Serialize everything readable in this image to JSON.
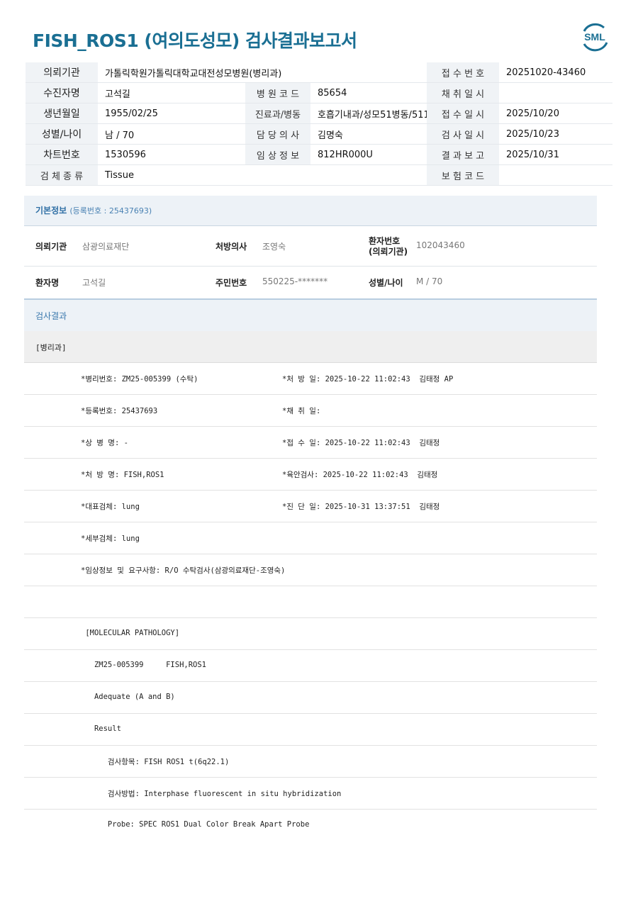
{
  "title": "FISH_ROS1 (여의도성모) 검사결과보고서",
  "logo": {
    "text": "SML",
    "color": "#1a6f93"
  },
  "info": {
    "rows": [
      [
        {
          "label": "의뢰기관",
          "value": "가톨릭학원가톨릭대학교대전성모병원(병리과)"
        },
        null,
        {
          "label": "접 수 번 호",
          "value": "20251020-43460"
        }
      ],
      [
        {
          "label": "수진자명",
          "value": "고석길"
        },
        {
          "label": "병 원 코 드",
          "value": "85654"
        },
        {
          "label": "채 취 일 시",
          "value": ""
        }
      ],
      [
        {
          "label": "생년월일",
          "value": "1955/02/25"
        },
        {
          "label": "진료과/병동",
          "value": "호흡기내과/성모51병동/5115"
        },
        {
          "label": "접 수 일 시",
          "value": "2025/10/20"
        }
      ],
      [
        {
          "label": "성별/나이",
          "value": "남 / 70"
        },
        {
          "label": "담 당 의 사",
          "value": "김명숙"
        },
        {
          "label": "검 사 일 시",
          "value": "2025/10/23"
        }
      ],
      [
        {
          "label": "차트번호",
          "value": "1530596"
        },
        {
          "label": "임 상 정 보",
          "value": "812HR000U"
        },
        {
          "label": "결 과 보 고",
          "value": "2025/10/31"
        }
      ],
      [
        {
          "label": "검 체 종 류",
          "value": "Tissue"
        },
        null,
        {
          "label": "보 험 코 드",
          "value": ""
        }
      ]
    ]
  },
  "basic": {
    "title": "기본정보",
    "reg": "(등록번호 : 25437693)",
    "row1": {
      "k1": "의뢰기관",
      "v1": "삼광의료재단",
      "k2": "처방의사",
      "v2": "조영숙",
      "k3a": "환자번호",
      "k3b": "(의뢰기관)",
      "v3": "102043460"
    },
    "row2": {
      "k1": "환자명",
      "v1": "고석길",
      "k2": "주민번호",
      "v2": "550225-*******",
      "k3": "성별/나이",
      "v3": "M / 70"
    }
  },
  "result": {
    "header": "검사결과",
    "sub": "[병리과]",
    "lines": [
      {
        "a": "*병리번호: ZM25-005399 (수탁)",
        "b": "*처 방 일: 2025-10-22 11:02:43  김태정 AP"
      },
      {
        "a": "*등록번호: 25437693",
        "b": "*채 취 일:"
      },
      {
        "a": "*상 병 명: -",
        "b": "*접 수 일: 2025-10-22 11:02:43  김태정"
      },
      {
        "a": "*처 방 명: FISH,ROS1",
        "b": "*육안검사: 2025-10-22 11:02:43  김태정"
      },
      {
        "a": "*대표검체: lung",
        "b": "*진 단 일: 2025-10-31 13:37:51  김태정"
      },
      {
        "a": "*세부검체: lung",
        "b": ""
      },
      {
        "a": "*임상정보 및 요구사항: R/O 수탁검사(삼광의료재단-조영숙)",
        "b": ""
      },
      {
        "a": "",
        "b": ""
      },
      {
        "a": " [MOLECULAR PATHOLOGY]",
        "b": ""
      },
      {
        "a": "   ZM25-005399     FISH,ROS1",
        "b": ""
      },
      {
        "a": "   Adequate (A and B)",
        "b": ""
      },
      {
        "a": "   Result",
        "b": ""
      },
      {
        "a": "      검사항목: FISH ROS1 t(6q22.1)",
        "b": ""
      },
      {
        "a": "      검사방법: Interphase fluorescent in situ hybridization",
        "b": ""
      },
      {
        "a": "      Probe: SPEC ROS1 Dual Color Break Apart Probe",
        "b": ""
      }
    ]
  }
}
